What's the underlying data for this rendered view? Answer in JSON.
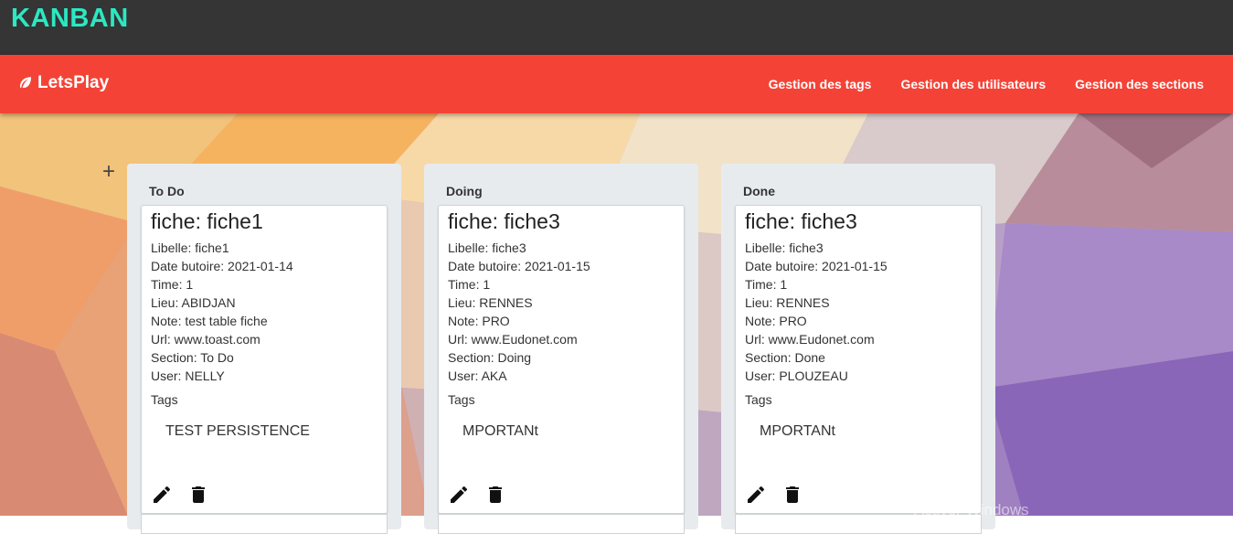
{
  "app": {
    "title": "KANBAN"
  },
  "navbar": {
    "brand": "LetsPlay",
    "links": [
      "Gestion des tags",
      "Gestion des utilisateurs",
      "Gestion des sections"
    ]
  },
  "board": {
    "add_label": "+",
    "columns": [
      {
        "title": "To Do",
        "card": {
          "title": "fiche: fiche1",
          "fields": [
            "Libelle: fiche1",
            "Date butoire: 2021-01-14",
            "Time: 1",
            "Lieu: ABIDJAN",
            "Note: test table fiche",
            "Url: www.toast.com",
            "Section: To Do",
            "User: NELLY"
          ],
          "tags_label": "Tags",
          "tag": "TEST PERSISTENCE"
        }
      },
      {
        "title": "Doing",
        "card": {
          "title": "fiche: fiche3",
          "fields": [
            "Libelle: fiche3",
            "Date butoire: 2021-01-15",
            "Time: 1",
            "Lieu: RENNES",
            "Note: PRO",
            "Url: www.Eudonet.com",
            "Section: Doing",
            "User: AKA"
          ],
          "tags_label": "Tags",
          "tag": "MPORTANt"
        }
      },
      {
        "title": "Done",
        "card": {
          "title": "fiche: fiche3",
          "fields": [
            "Libelle: fiche3",
            "Date butoire: 2021-01-15",
            "Time: 1",
            "Lieu: RENNES",
            "Note: PRO",
            "Url: www.Eudonet.com",
            "Section: Done",
            "User: PLOUZEAU"
          ],
          "tags_label": "Tags",
          "tag": "MPORTANt"
        }
      }
    ]
  },
  "watermark": "Activer Windows",
  "colors": {
    "topbar": "#353535",
    "title": "#2ce8c2",
    "navbar": "#f44336"
  }
}
